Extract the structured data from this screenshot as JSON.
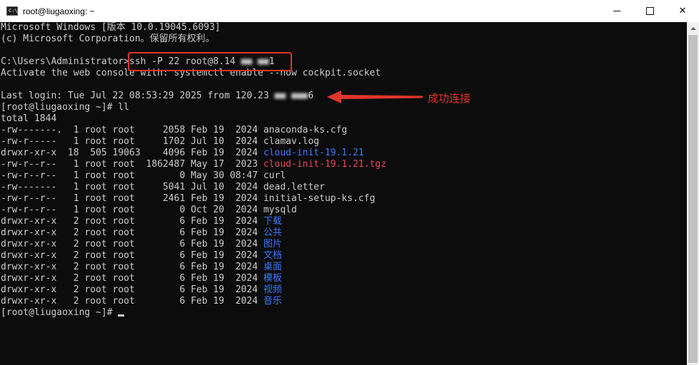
{
  "window": {
    "title": "root@liugaoxing: ~",
    "app_icon_text": "C:\\"
  },
  "terminal": {
    "header_line1": "Microsoft Windows [版本 10.0.19045.6093]",
    "header_line2": "(c) Microsoft Corporation。保留所有权利。",
    "prompt_cmd_prefix": "C:\\Users\\Administrator>",
    "ssh_command_visible": "ssh -P 22 root@8.14",
    "ssh_command_redacted": " ■■ ■■",
    "ssh_command_suffix": "1",
    "activate_line": "Activate the web console with: systemctl enable --now cockpit.socket",
    "last_login_prefix": "Last login: Tue Jul 22 08:53:29 2025 from 120.23",
    "last_login_redacted": " ■■ ■■■",
    "last_login_suffix": "6",
    "prompt_ll": "[root@liugaoxing ~]# ll",
    "total_line": "total 1844",
    "listing": [
      {
        "perm_owner": "-rw-------.  1 root root     2058 Feb 19  2024 ",
        "name": "anaconda-ks.cfg",
        "color": "default"
      },
      {
        "perm_owner": "-rw-r-----   1 root root     1702 Jul 10  2024 ",
        "name": "clamav.log",
        "color": "default"
      },
      {
        "perm_owner": "drwxr-xr-x  18  505 19063    4096 Feb 19  2024 ",
        "name": "cloud-init-19.1.21",
        "color": "blue"
      },
      {
        "perm_owner": "-rw-r--r--   1 root root  1862487 May 17  2023 ",
        "name": "cloud-init-19.1.21.tgz",
        "color": "red"
      },
      {
        "perm_owner": "-rw-r--r--   1 root root        0 May 30 08:47 ",
        "name": "curl",
        "color": "default"
      },
      {
        "perm_owner": "-rw-------   1 root root     5041 Jul 10  2024 ",
        "name": "dead.letter",
        "color": "default"
      },
      {
        "perm_owner": "-rw-r--r--   1 root root     2461 Feb 19  2024 ",
        "name": "initial-setup-ks.cfg",
        "color": "default"
      },
      {
        "perm_owner": "-rw-r--r--   1 root root        0 Oct 20  2024 ",
        "name": "mysqld",
        "color": "default"
      },
      {
        "perm_owner": "drwxr-xr-x   2 root root        6 Feb 19  2024 ",
        "name": "下载",
        "color": "blue"
      },
      {
        "perm_owner": "drwxr-xr-x   2 root root        6 Feb 19  2024 ",
        "name": "公共",
        "color": "blue"
      },
      {
        "perm_owner": "drwxr-xr-x   2 root root        6 Feb 19  2024 ",
        "name": "图片",
        "color": "blue"
      },
      {
        "perm_owner": "drwxr-xr-x   2 root root        6 Feb 19  2024 ",
        "name": "文档",
        "color": "blue"
      },
      {
        "perm_owner": "drwxr-xr-x   2 root root        6 Feb 19  2024 ",
        "name": "桌面",
        "color": "blue"
      },
      {
        "perm_owner": "drwxr-xr-x   2 root root        6 Feb 19  2024 ",
        "name": "模板",
        "color": "blue"
      },
      {
        "perm_owner": "drwxr-xr-x   2 root root        6 Feb 19  2024 ",
        "name": "视频",
        "color": "blue"
      },
      {
        "perm_owner": "drwxr-xr-x   2 root root        6 Feb 19  2024 ",
        "name": "音乐",
        "color": "blue"
      }
    ],
    "final_prompt": "[root@liugaoxing ~]# "
  },
  "annotation": {
    "label": "成功连接",
    "color": "#e0362c"
  },
  "colors": {
    "background": "#0c0c0c",
    "text": "#cccccc",
    "directory_blue": "#3b78ff",
    "archive_red": "#e74856"
  }
}
